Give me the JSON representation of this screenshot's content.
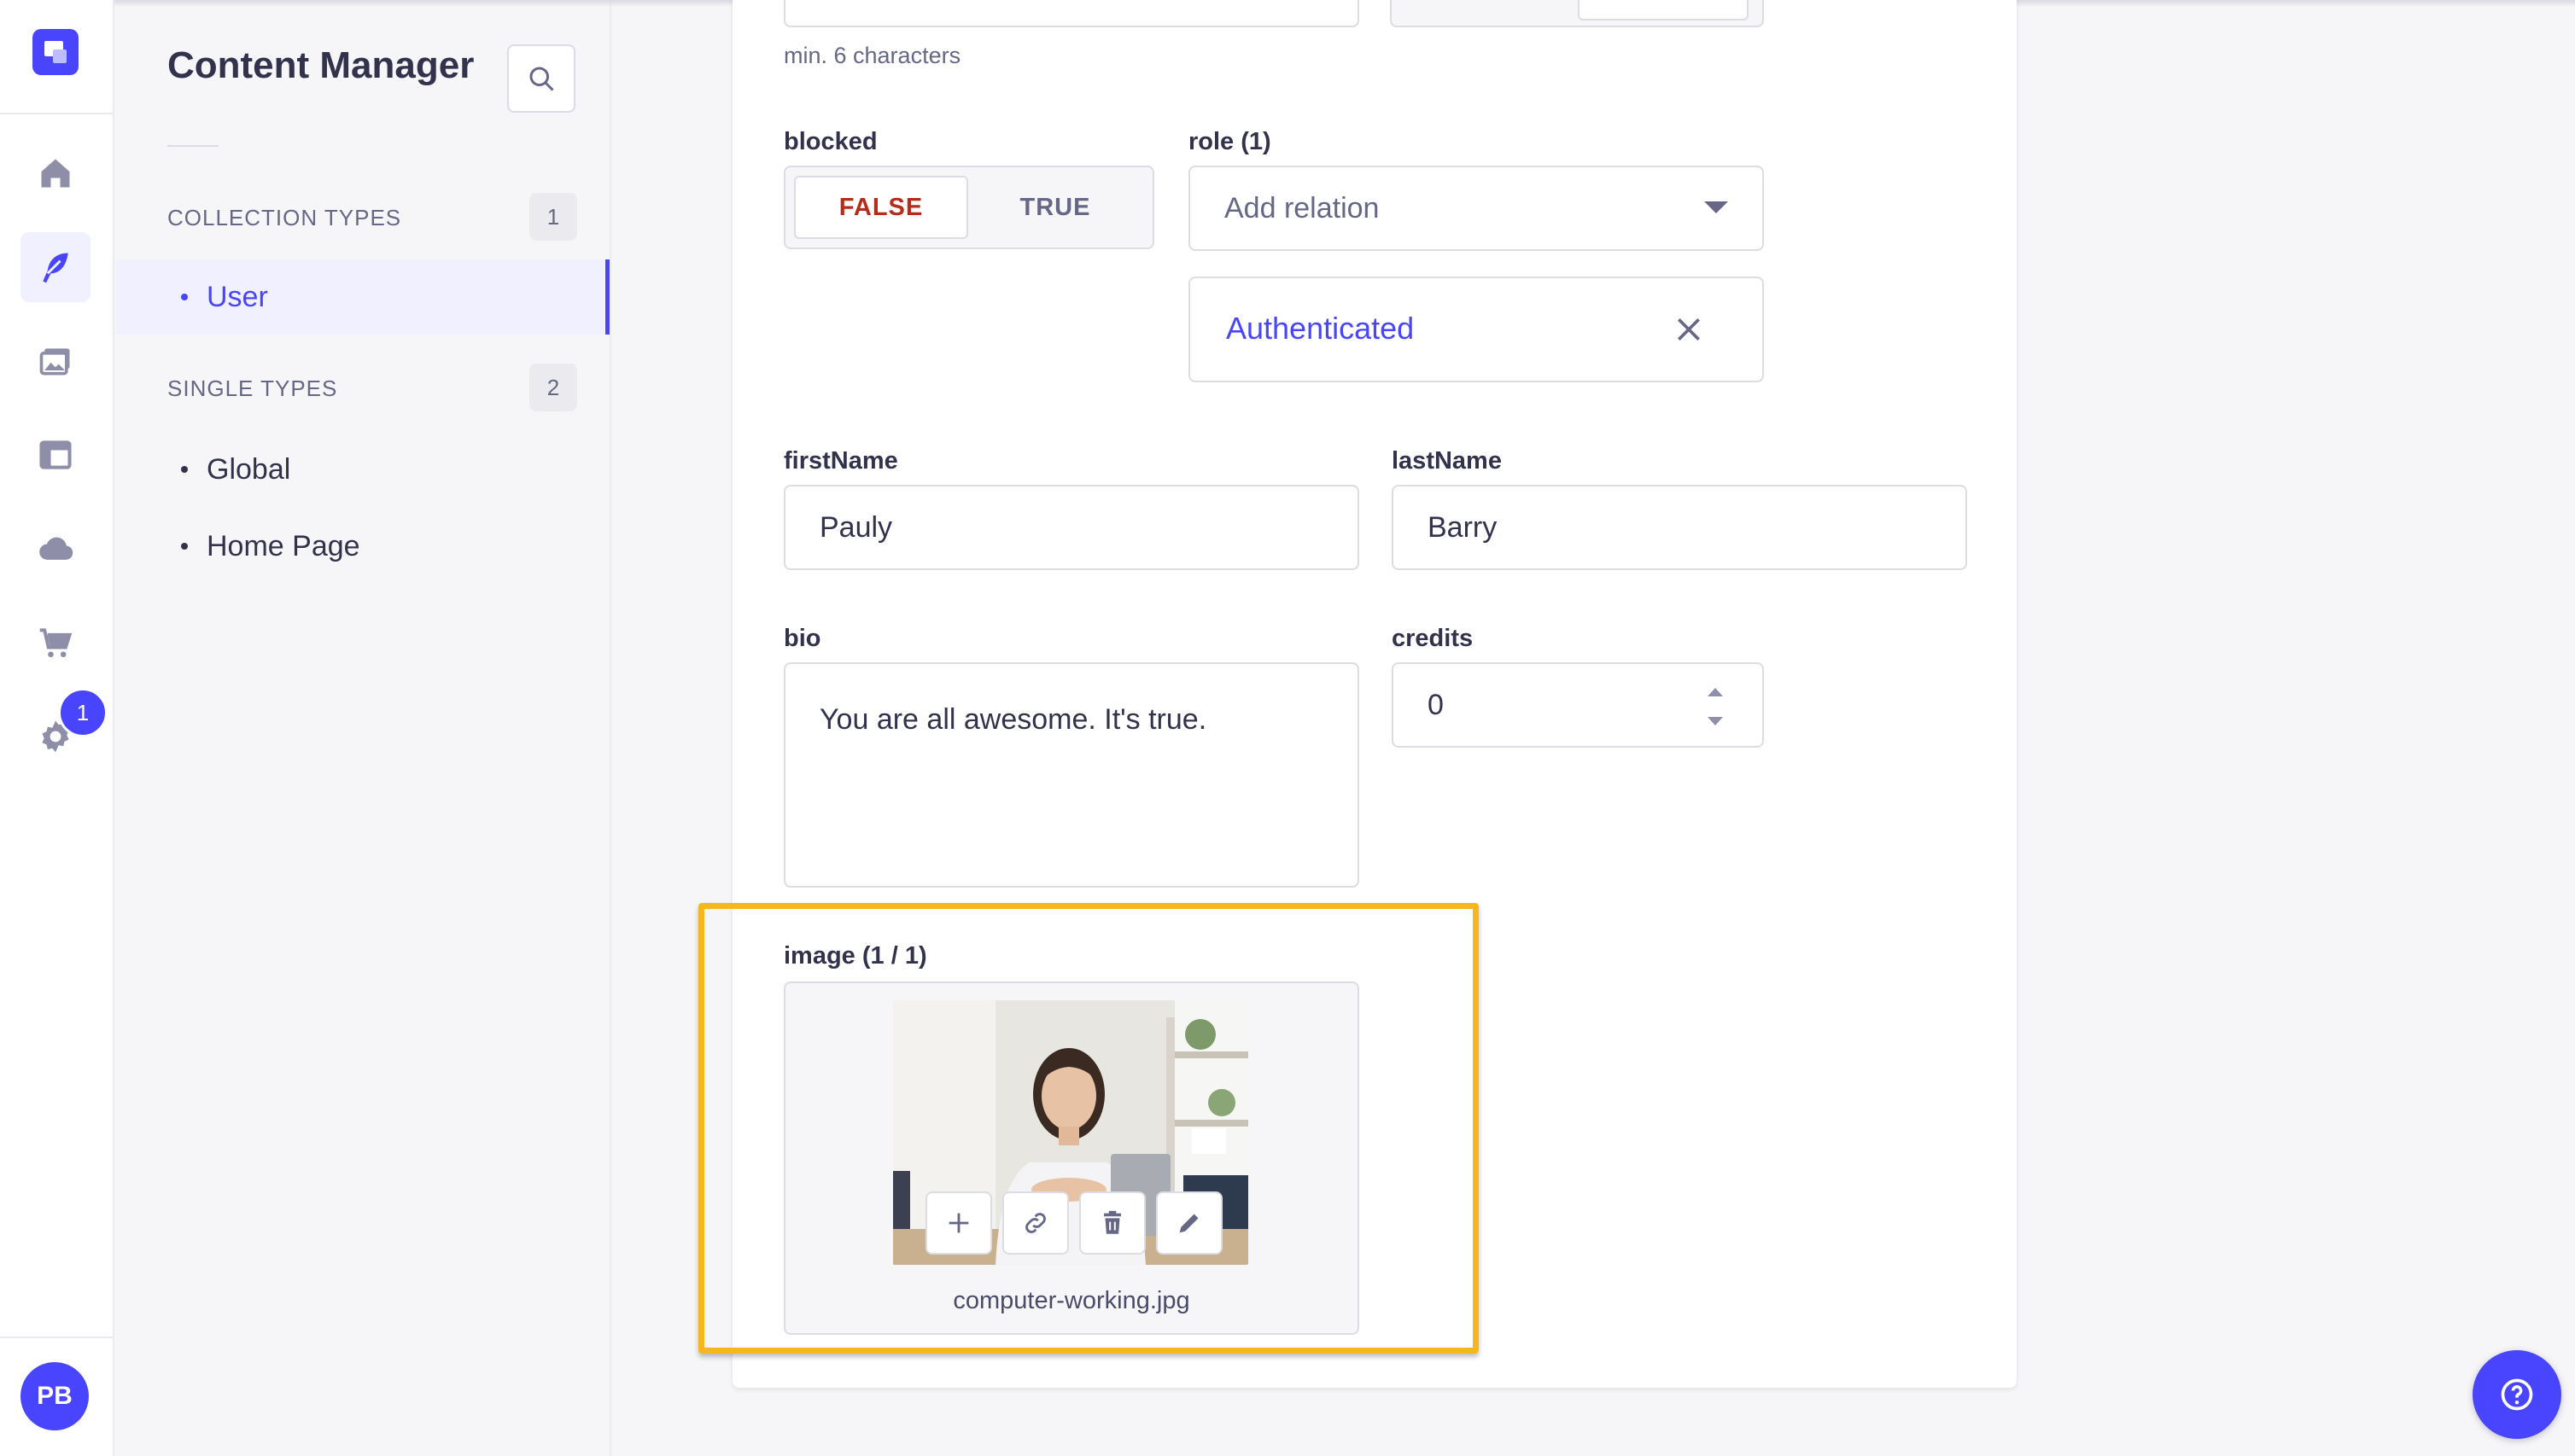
{
  "app": {
    "accent_color": "#4945ff",
    "highlight_color": "#f5b71c"
  },
  "rail": {
    "items": [
      {
        "name": "home-icon"
      },
      {
        "name": "feather-icon",
        "active": true
      },
      {
        "name": "media-library-icon"
      },
      {
        "name": "layout-icon"
      },
      {
        "name": "cloud-icon"
      },
      {
        "name": "cart-icon"
      },
      {
        "name": "gear-icon"
      }
    ],
    "settings_badge": "1",
    "avatar_initials": "PB"
  },
  "subnav": {
    "title": "Content Manager",
    "collection_types": {
      "heading": "COLLECTION TYPES",
      "count": "1",
      "items": [
        {
          "label": "User",
          "active": true
        }
      ]
    },
    "single_types": {
      "heading": "SINGLE TYPES",
      "count": "2",
      "items": [
        {
          "label": "Global"
        },
        {
          "label": "Home Page"
        }
      ]
    }
  },
  "form": {
    "password_hint": "min. 6 characters",
    "blocked": {
      "label": "blocked",
      "false_label": "FALSE",
      "true_label": "TRUE",
      "selected": "FALSE"
    },
    "role": {
      "label": "role (1)",
      "placeholder": "Add relation",
      "selected_item": "Authenticated"
    },
    "firstName": {
      "label": "firstName",
      "value": "Pauly"
    },
    "lastName": {
      "label": "lastName",
      "value": "Barry"
    },
    "bio": {
      "label": "bio",
      "value": "You are all awesome. It's true."
    },
    "credits": {
      "label": "credits",
      "value": "0"
    },
    "image": {
      "label": "image (1 / 1)",
      "file_name": "computer-working.jpg",
      "actions": [
        "plus-icon",
        "link-icon",
        "trash-icon",
        "pencil-icon"
      ]
    }
  }
}
